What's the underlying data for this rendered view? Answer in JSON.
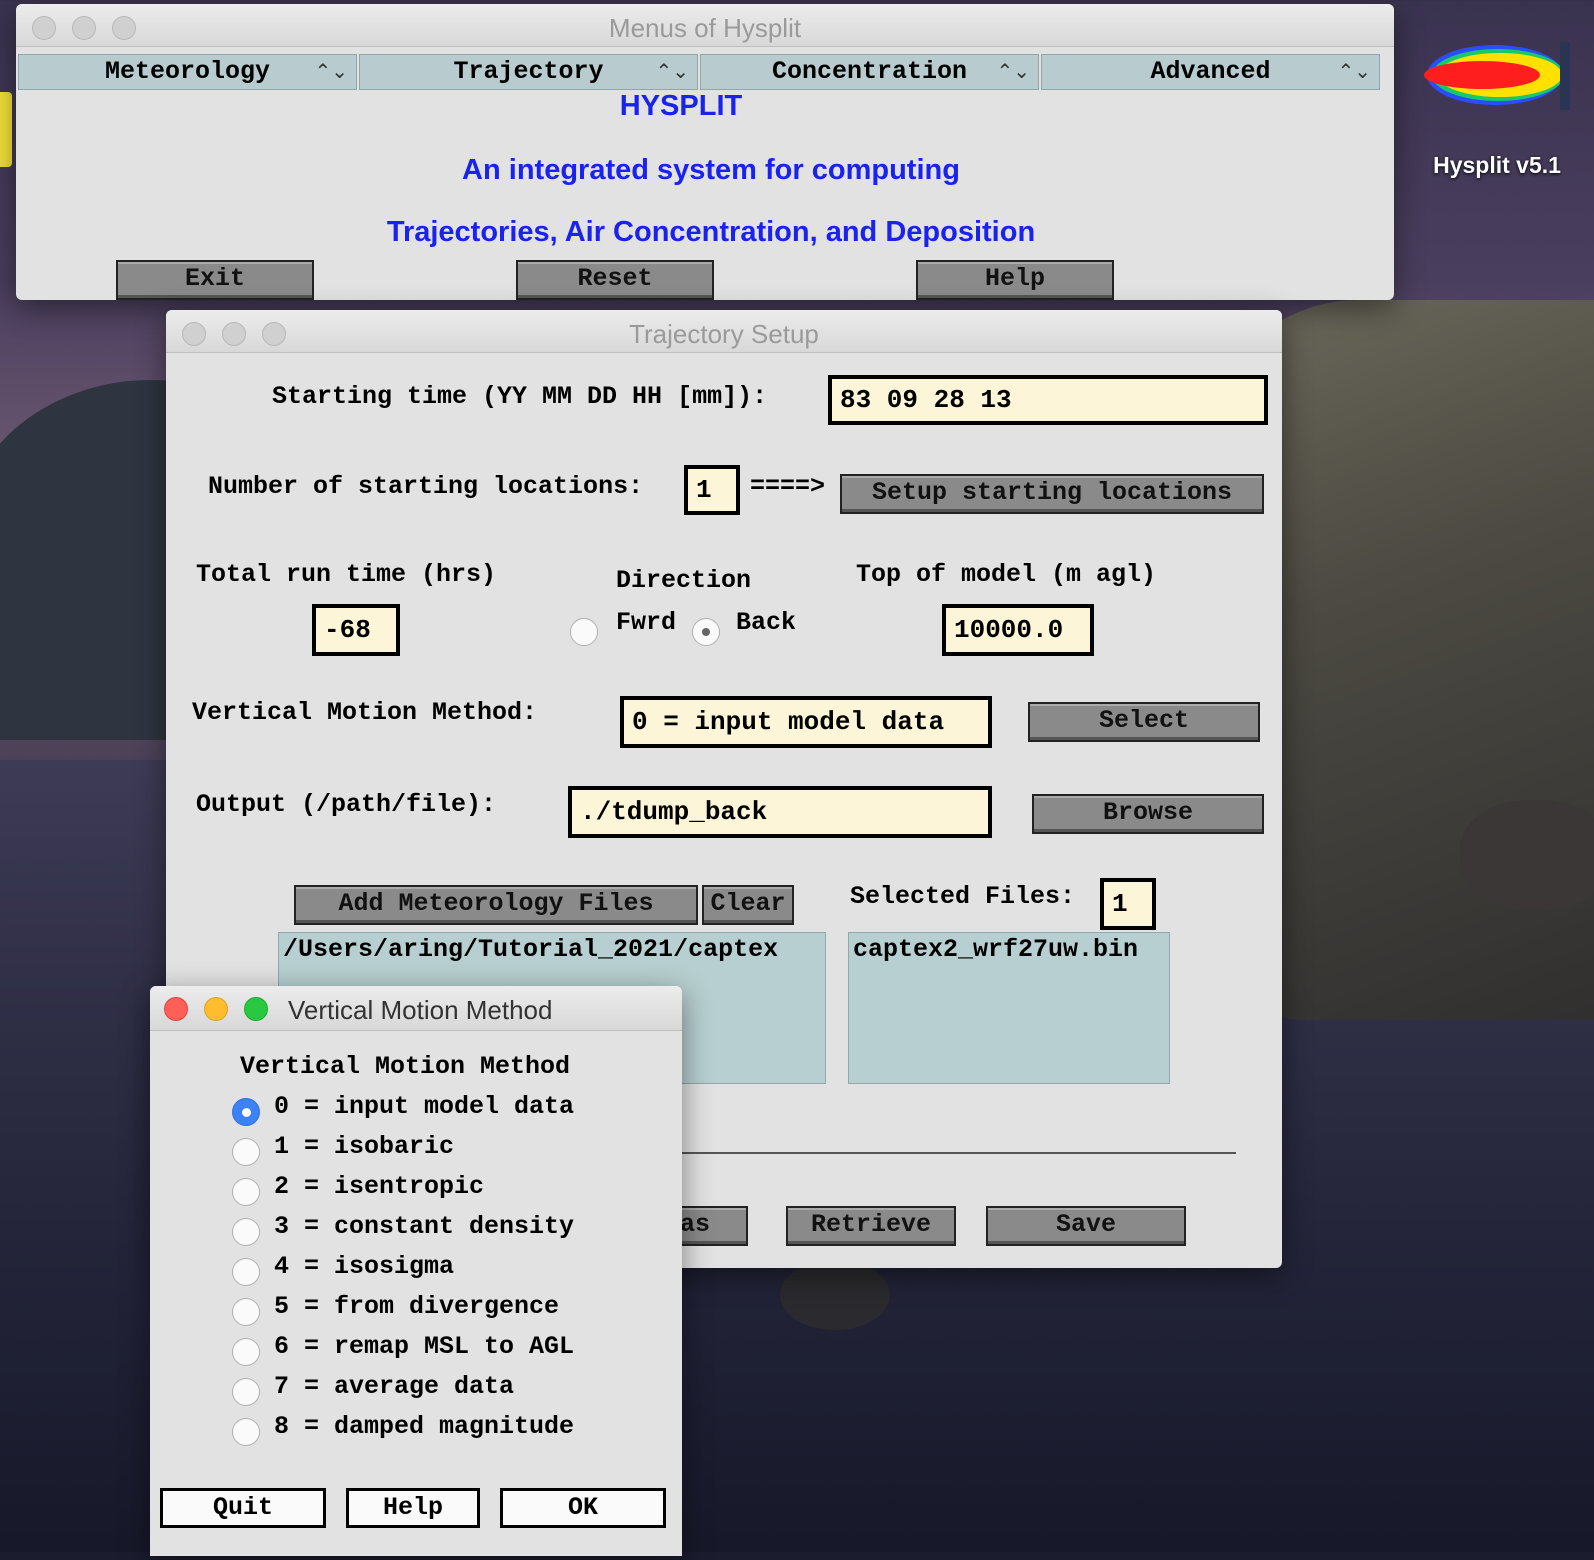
{
  "desktop": {
    "app_label": "Hysplit v5.1"
  },
  "menus_window": {
    "title": "Menus of Hysplit",
    "menus": [
      {
        "label": "Meteorology"
      },
      {
        "label": "Trajectory"
      },
      {
        "label": "Concentration"
      },
      {
        "label": "Advanced"
      }
    ],
    "heading": "HYSPLIT",
    "line1": "An integrated system for computing",
    "line2": "Trajectories, Air Concentration, and Deposition",
    "buttons": {
      "exit": "Exit",
      "reset": "Reset",
      "help": "Help"
    }
  },
  "trajectory_window": {
    "title": "Trajectory Setup",
    "starting_time_label": "Starting time (YY MM DD HH [mm]):",
    "starting_time_value": "83 09 28 13",
    "num_locations_label": "Number of starting locations:",
    "num_locations_value": "1",
    "arrow": "====>",
    "setup_locations_button": "Setup starting locations",
    "run_time_label": "Total run time (hrs)",
    "run_time_value": "-68",
    "direction_label": "Direction",
    "direction_fwrd": "Fwrd",
    "direction_back": "Back",
    "direction_selected": "Back",
    "top_model_label": "Top of model (m agl)",
    "top_model_value": "10000.0",
    "vertical_label": "Vertical Motion Method:",
    "vertical_value": "0 = input model data",
    "select_button": "Select",
    "output_label": "Output (/path/file):",
    "output_value": "./tdump_back",
    "browse_button": "Browse",
    "add_met_button": "Add Meteorology Files",
    "clear_button": "Clear",
    "selected_files_label": "Selected Files:",
    "selected_files_count": "1",
    "met_dir": "/Users/aring/Tutorial_2021/captex",
    "met_file": "captex2_wrf27uw.bin",
    "save_as_button_partial": "as",
    "retrieve_button": "Retrieve",
    "save_button": "Save"
  },
  "vertical_window": {
    "title": "Vertical Motion Method",
    "heading": "Vertical Motion Method",
    "options": [
      {
        "label": "0 = input model data",
        "selected": true
      },
      {
        "label": "1 = isobaric",
        "selected": false
      },
      {
        "label": "2 = isentropic",
        "selected": false
      },
      {
        "label": "3 = constant density",
        "selected": false
      },
      {
        "label": "4 = isosigma",
        "selected": false
      },
      {
        "label": "5 = from divergence",
        "selected": false
      },
      {
        "label": "6 = remap MSL to AGL",
        "selected": false
      },
      {
        "label": "7 = average data",
        "selected": false
      },
      {
        "label": "8 = damped magnitude",
        "selected": false
      }
    ],
    "buttons": {
      "quit": "Quit",
      "help": "Help",
      "ok": "OK"
    }
  },
  "colors": {
    "accent_blue": "#1a22ee",
    "field_bg": "#fdf5d8",
    "list_bg": "#b7cfd0",
    "button_grey": "#8a8a8a",
    "close_red": "#fe5f57",
    "min_yellow": "#febc2e",
    "max_green": "#28c840"
  }
}
